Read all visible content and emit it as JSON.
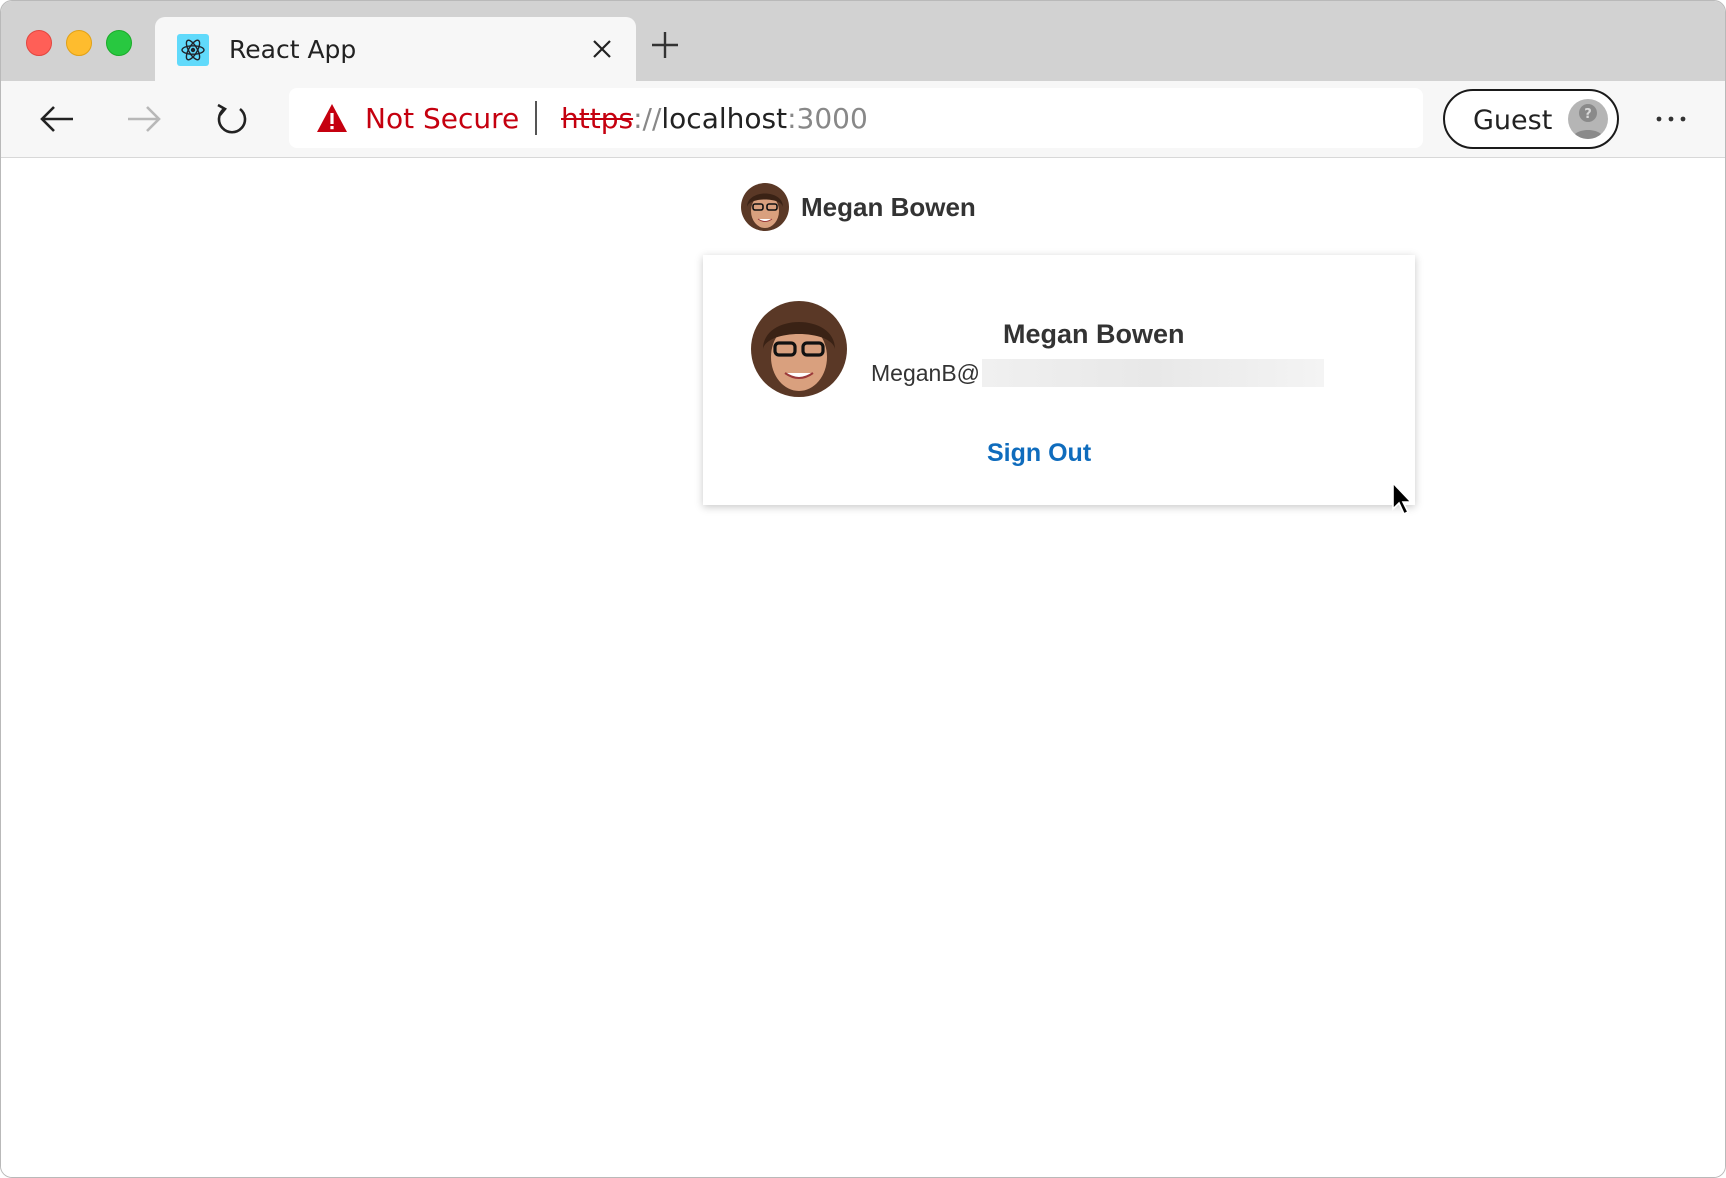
{
  "browser": {
    "tab": {
      "title": "React App",
      "favicon": "react-logo-icon"
    },
    "toolbar": {
      "security_label": "Not Secure",
      "url": {
        "scheme": "https",
        "separator": "://",
        "host": "localhost",
        "port": ":3000"
      },
      "profile_label": "Guest",
      "more_label": "···"
    },
    "colors": {
      "warning": "#c5000f",
      "accent": "#0f6cbd"
    }
  },
  "page": {
    "login_button": {
      "name": "Megan Bowen"
    },
    "flyout": {
      "name": "Megan Bowen",
      "email_visible": "MeganB@",
      "sign_out_label": "Sign Out"
    }
  }
}
